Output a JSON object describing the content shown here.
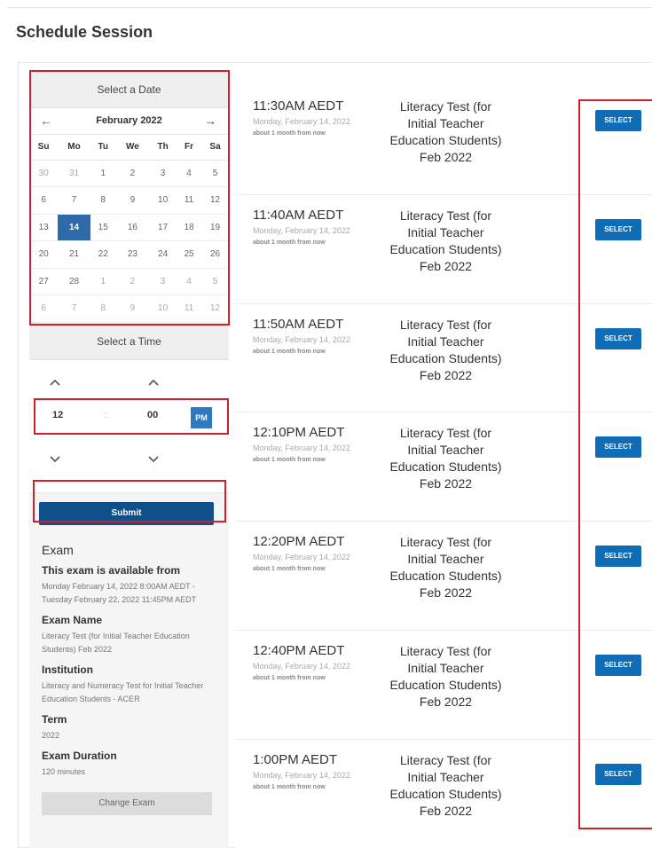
{
  "page_title": "Schedule Session",
  "date_picker": {
    "header": "Select a Date",
    "prev_icon": "←",
    "next_icon": "→",
    "month": "February 2022",
    "weekdays": [
      "Su",
      "Mo",
      "Tu",
      "We",
      "Th",
      "Fr",
      "Sa"
    ],
    "weeks": [
      [
        "30",
        "31",
        "1",
        "2",
        "3",
        "4",
        "5"
      ],
      [
        "6",
        "7",
        "8",
        "9",
        "10",
        "11",
        "12"
      ],
      [
        "13",
        "14",
        "15",
        "16",
        "17",
        "18",
        "19"
      ],
      [
        "20",
        "21",
        "22",
        "23",
        "24",
        "25",
        "26"
      ],
      [
        "27",
        "28",
        "1",
        "2",
        "3",
        "4",
        "5"
      ],
      [
        "6",
        "7",
        "8",
        "9",
        "10",
        "11",
        "12"
      ]
    ],
    "selected_day": "14"
  },
  "time_picker": {
    "header": "Select a Time",
    "hour": "12",
    "separator": ":",
    "minute": "00",
    "ampm": "PM"
  },
  "submit_label": "Submit",
  "exam": {
    "heading": "Exam",
    "available_label": "This exam is available from",
    "available_value": "Monday February 14, 2022 8:00AM AEDT - Tuesday February 22, 2022 11:45PM AEDT",
    "name_label": "Exam Name",
    "name_value": "Literacy Test (for Initial Teacher Education Students) Feb 2022",
    "institution_label": "Institution",
    "institution_value": "Literacy and Numeracy Test for Initial Teacher Education Students - ACER",
    "term_label": "Term",
    "term_value": "2022",
    "duration_label": "Exam Duration",
    "duration_value": "120 minutes",
    "change_label": "Change Exam"
  },
  "slots": [
    {
      "time": "11:30AM AEDT",
      "date": "Monday, February 14, 2022",
      "relative": "about 1 month from now",
      "exam": "Literacy Test (for Initial Teacher Education Students) Feb 2022",
      "action": "SELECT"
    },
    {
      "time": "11:40AM AEDT",
      "date": "Monday, February 14, 2022",
      "relative": "about 1 month from now",
      "exam": "Literacy Test (for Initial Teacher Education Students) Feb 2022",
      "action": "SELECT"
    },
    {
      "time": "11:50AM AEDT",
      "date": "Monday, February 14, 2022",
      "relative": "about 1 month from now",
      "exam": "Literacy Test (for Initial Teacher Education Students) Feb 2022",
      "action": "SELECT"
    },
    {
      "time": "12:10PM AEDT",
      "date": "Monday, February 14, 2022",
      "relative": "about 1 month from now",
      "exam": "Literacy Test (for Initial Teacher Education Students) Feb 2022",
      "action": "SELECT"
    },
    {
      "time": "12:20PM AEDT",
      "date": "Monday, February 14, 2022",
      "relative": "about 1 month from now",
      "exam": "Literacy Test (for Initial Teacher Education Students) Feb 2022",
      "action": "SELECT"
    },
    {
      "time": "12:40PM AEDT",
      "date": "Monday, February 14, 2022",
      "relative": "about 1 month from now",
      "exam": "Literacy Test (for Initial Teacher Education Students) Feb 2022",
      "action": "SELECT"
    },
    {
      "time": "1:00PM AEDT",
      "date": "Monday, February 14, 2022",
      "relative": "about 1 month from now",
      "exam": "Literacy Test (for Initial Teacher Education Students) Feb 2022",
      "action": "SELECT"
    }
  ],
  "colors": {
    "accent": "#0f6cb6",
    "submit": "#0f4f8a",
    "selected_day": "#2e6aa8",
    "annotation": "#d0202a"
  }
}
